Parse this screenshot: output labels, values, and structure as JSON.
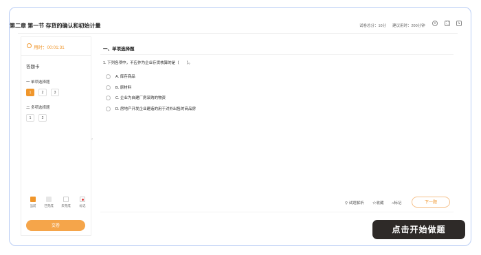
{
  "header": {
    "title": "第二章 第一节 存货的确认和初始计量",
    "total_score": "试卷总分：10分",
    "suggested_time": "建议用时：200分钟"
  },
  "sidebar": {
    "timer": "用时：00:01:31",
    "card_title": "答题卡",
    "sections": [
      {
        "label": "一 单项选择题",
        "questions": [
          "1",
          "2",
          "3"
        ]
      },
      {
        "label": "二 多项选择题",
        "questions": [
          "1",
          "2"
        ]
      }
    ],
    "legend": [
      {
        "label": "当前",
        "color": "#f0962b"
      },
      {
        "label": "已完成",
        "color": "#e6e6e6"
      },
      {
        "label": "未完成",
        "color": "#ffffff"
      },
      {
        "label": "标记",
        "color": "#e23c3c"
      }
    ],
    "submit_label": "交卷"
  },
  "main": {
    "section_title": "一、单项选择题",
    "question": "1. 下列各项中，不应作为企业存货核算的是（　　）。",
    "options": [
      "A. 库存商品",
      "B. 原材料",
      "C. 企业为自建厂房采购的物资",
      "D. 房地产开发企业建造的用于对外出售的商品房"
    ],
    "tools": {
      "analysis": "试题解析",
      "favorite": "收藏",
      "mark": "标记"
    },
    "next_label": "下一题"
  },
  "overlay": {
    "start_label": "点击开始做题"
  },
  "colors": {
    "accent": "#f0962b",
    "frame_border": "#b9cdf5",
    "overlay_bg": "#2e2a28"
  }
}
